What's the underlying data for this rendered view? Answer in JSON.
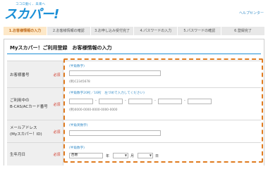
{
  "header": {
    "logo_tagline": "ココロ動く、未来へ",
    "logo_text": "スカパー!",
    "help_link": "ヘルプセンター"
  },
  "steps": [
    {
      "label": "1.お客様情報の入力",
      "active": true
    },
    {
      "label": "2.お客様情報の確認",
      "active": false
    },
    {
      "label": "3.お申し込み受付完了",
      "active": false
    },
    {
      "label": "4.パスワードの入力",
      "active": false
    },
    {
      "label": "5.パスワードの確認",
      "active": false
    },
    {
      "label": "6.登録完了",
      "active": false
    }
  ],
  "page_title": "Myスカパー！ご利用登録　お客様情報の入力",
  "required_label": "必須",
  "form": {
    "customer_number": {
      "label": "お客様番号",
      "hint": "(半角数字)",
      "value": "",
      "example": "(例)C2345678"
    },
    "card_number": {
      "label_line1": "ご利用中の",
      "label_line2": "B-CAS/ACカード番号",
      "hint": "(半角数字20桁／16桁　左づめで入力してください)",
      "segments": [
        "",
        "",
        "",
        "",
        ""
      ],
      "example": "(例)0000-0000-0000-0000-0000"
    },
    "email": {
      "label_line1": "メールアドレス",
      "label_line2": "(Myスカパー！ID)",
      "hint": "(半角英数字)",
      "value": ""
    },
    "birthdate": {
      "label": "生年月日",
      "hint": "(半角数字)",
      "era": "西暦",
      "year_unit": "年",
      "month_unit": "月",
      "day_unit": "日"
    }
  },
  "colors": {
    "brand": "#1a8fd6",
    "highlight": "#e07b1f",
    "required": "#d23b2a",
    "active_step_bg": "#fde8c8"
  }
}
